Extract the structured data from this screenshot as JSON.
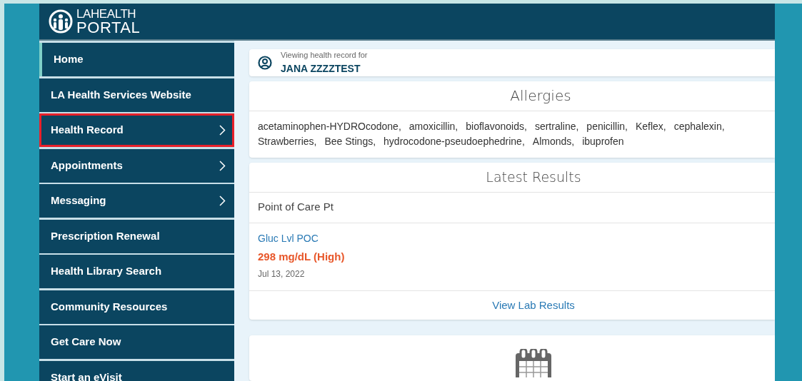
{
  "logo": {
    "line1": "**LA**HEALTH",
    "line2": "PORTAL"
  },
  "sidebar": {
    "items": [
      {
        "label": "Home",
        "selected": true,
        "highlighted": false,
        "has_submenu": false
      },
      {
        "label": "LA Health Services Website",
        "selected": false,
        "highlighted": false,
        "has_submenu": false
      },
      {
        "label": "Health Record",
        "selected": false,
        "highlighted": true,
        "has_submenu": true
      },
      {
        "label": "Appointments",
        "selected": false,
        "highlighted": false,
        "has_submenu": true
      },
      {
        "label": "Messaging",
        "selected": false,
        "highlighted": false,
        "has_submenu": true
      },
      {
        "label": "Prescription Renewal",
        "selected": false,
        "highlighted": false,
        "has_submenu": false
      },
      {
        "label": "Health Library Search",
        "selected": false,
        "highlighted": false,
        "has_submenu": false
      },
      {
        "label": "Community Resources",
        "selected": false,
        "highlighted": false,
        "has_submenu": false
      },
      {
        "label": "Get Care Now",
        "selected": false,
        "highlighted": false,
        "has_submenu": false
      },
      {
        "label": "Start an eVisit",
        "selected": false,
        "highlighted": false,
        "has_submenu": false
      }
    ]
  },
  "patient": {
    "caption": "Viewing health record for",
    "name": "JANA ZZZZTEST"
  },
  "allergies": {
    "title": "Allergies",
    "items": [
      "acetaminophen-HYDROcodone,",
      "amoxicillin,",
      "bioflavonoids,",
      "sertraline,",
      "penicillin,",
      "Keflex,",
      "cephalexin,",
      "Strawberries,",
      "Bee Stings,",
      "hydrocodone-pseudoephedrine,",
      "Almonds,",
      "ibuprofen"
    ]
  },
  "latest_results": {
    "title": "Latest Results",
    "group": "Point of Care Pt",
    "results": [
      {
        "name": "Gluc Lvl POC",
        "value": "298 mg/dL (High)",
        "abnormal": true,
        "date": "Jul 13, 2022"
      }
    ],
    "link": "View Lab Results"
  }
}
